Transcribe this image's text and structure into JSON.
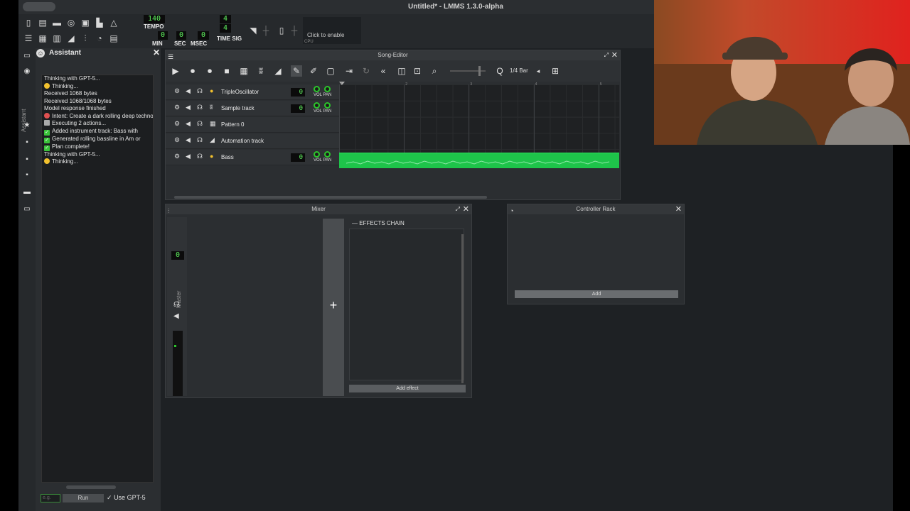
{
  "window": {
    "title": "Untitled* - LMMS 1.3.0-alpha"
  },
  "transport": {
    "tempo": "140",
    "tempo_label": "TEMPO",
    "min": "0",
    "sec": "0",
    "msec": "0",
    "min_label": "MIN",
    "sec_label": "SEC",
    "msec_label": "MSEC",
    "timesig_num": "4",
    "timesig_den": "4",
    "timesig_label": "TIME SIG",
    "cpu_click": "Click to enable",
    "cpu_label": "CPU"
  },
  "sidebar": {
    "tab_label": "Assistant"
  },
  "assistant": {
    "title": "Assistant",
    "log": [
      {
        "icon": "",
        "text": "Thinking with GPT-5..."
      },
      {
        "icon": "thinking",
        "text": "Thinking..."
      },
      {
        "icon": "",
        "text": "Received 1068 bytes"
      },
      {
        "icon": "",
        "text": "Received 1068/1068 bytes"
      },
      {
        "icon": "",
        "text": "Model response finished"
      },
      {
        "icon": "intent",
        "text": "Intent: Create a dark rolling deep techno"
      },
      {
        "icon": "exec",
        "text": "Executing 2 actions..."
      },
      {
        "icon": "check",
        "text": "Added instrument track: Bass with"
      },
      {
        "icon": "check",
        "text": "Generated rolling bassline in Am or"
      },
      {
        "icon": "check",
        "text": "Plan complete!"
      },
      {
        "icon": "",
        "text": "Thinking with GPT-5..."
      },
      {
        "icon": "thinking",
        "text": "Thinking..."
      }
    ],
    "input_placeholder": "e.g.",
    "run_label": "Run",
    "use_gpt_label": "Use GPT-5",
    "use_gpt_checked": true
  },
  "song_editor": {
    "title": "Song-Editor",
    "quantize": "1/4 Bar",
    "bar_numbers": [
      "1",
      "2",
      "3",
      "4",
      "5"
    ],
    "tracks": [
      {
        "name": "TripleOscillator",
        "type": "instrument",
        "volume": "0"
      },
      {
        "name": "Sample track",
        "type": "sample",
        "volume": "0"
      },
      {
        "name": "Pattern 0",
        "type": "pattern",
        "volume": ""
      },
      {
        "name": "Automation track",
        "type": "automation",
        "volume": ""
      },
      {
        "name": "Bass",
        "type": "instrument",
        "volume": "0"
      }
    ],
    "vol_pan_label": "VOL PAN",
    "bass_clip_color": "#1ec44a"
  },
  "mixer": {
    "title": "Mixer",
    "master_label": "Master",
    "master_value": "0",
    "add_channel_symbol": "+",
    "effects_chain_label": "EFFECTS CHAIN",
    "add_effect_label": "Add effect"
  },
  "controller_rack": {
    "title": "Controller Rack",
    "add_label": "Add"
  },
  "colors": {
    "lcd_green": "#5ff25f",
    "accent_green": "#2cc62c"
  }
}
